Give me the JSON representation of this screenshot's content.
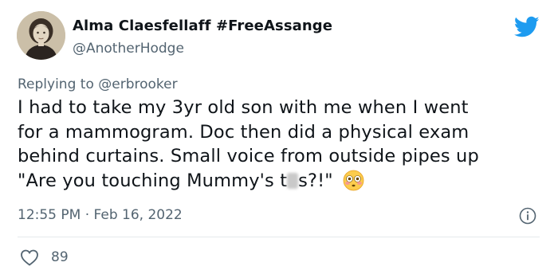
{
  "user": {
    "display_name": "Alma Claesfellaff #FreeAssange",
    "handle": "@AnotherHodge",
    "avatar_icon": "portrait-photo"
  },
  "reply": {
    "prefix": "Replying to ",
    "mention": "@erbrooker"
  },
  "tweet": {
    "line1": "I had to take my 3yr old son with me when I went",
    "line2": "for a mammogram. Doc then did a physical exam",
    "line3": "behind curtains. Small voice from outside pipes up",
    "line4_before": "\"Are you touching Mummy's t",
    "line4_after": "s?!\"",
    "emoji": "flushed-face-emoji"
  },
  "meta": {
    "timestamp": "12:55 PM · Feb 16, 2022"
  },
  "engagement": {
    "likes": "89"
  },
  "colors": {
    "brand_blue": "#1d9bf0",
    "text_primary": "#0f1419",
    "text_secondary": "#536471"
  }
}
